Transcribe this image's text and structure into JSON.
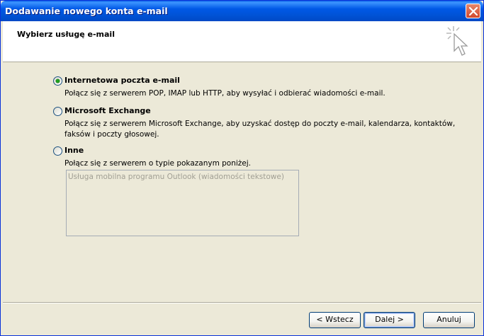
{
  "window": {
    "title": "Dodawanie nowego konta e-mail"
  },
  "header": {
    "title": "Wybierz usługę e-mail"
  },
  "options": [
    {
      "label": "Internetowa poczta e-mail",
      "description": "Połącz się z serwerem POP, IMAP lub HTTP, aby wysyłać i odbierać wiadomości e-mail.",
      "selected": true
    },
    {
      "label": "Microsoft Exchange",
      "description": "Połącz się z serwerem Microsoft Exchange, aby uzyskać dostęp do poczty e-mail, kalendarza, kontaktów, faksów i poczty głosowej.",
      "selected": false
    },
    {
      "label": "Inne",
      "description": "Połącz się z serwerem o typie pokazanym poniżej.",
      "selected": false
    }
  ],
  "listbox": {
    "items": [
      "Usługa mobilna programu Outlook (wiadomości tekstowe)"
    ]
  },
  "buttons": {
    "back": "< Wstecz",
    "next": "Dalej >",
    "cancel": "Anuluj"
  }
}
